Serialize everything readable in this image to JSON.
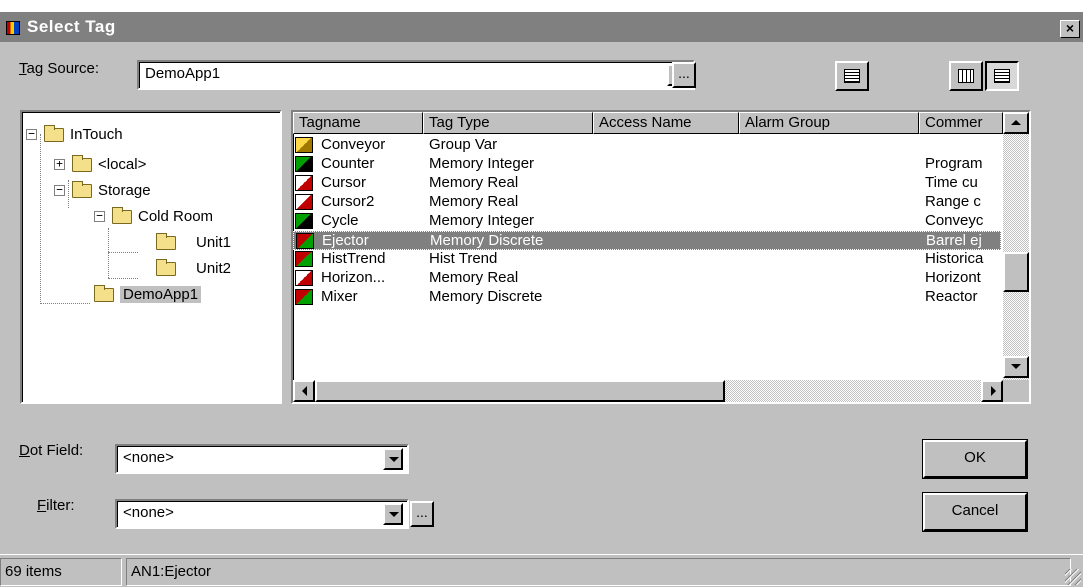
{
  "title": "Select Tag",
  "tag_source": {
    "label_accel": "T",
    "label_rest": "ag Source:",
    "value": "DemoApp1"
  },
  "tree": {
    "root": "InTouch",
    "local": "<local>",
    "storage": "Storage",
    "cold_room": "Cold Room",
    "unit1": "Unit1",
    "unit2": "Unit2",
    "demoapp": "DemoApp1"
  },
  "columns": [
    "Tagname",
    "Tag Type",
    "Access Name",
    "Alarm Group",
    "Commer"
  ],
  "rows": [
    {
      "name": "Conveyor",
      "type": "Group Var",
      "comment": "",
      "icon": "group-var-icon"
    },
    {
      "name": "Counter",
      "type": "Memory Integer",
      "comment": "Program",
      "icon": "memory-integer-icon"
    },
    {
      "name": "Cursor",
      "type": "Memory Real",
      "comment": "Time cu",
      "icon": "memory-real-icon"
    },
    {
      "name": "Cursor2",
      "type": "Memory Real",
      "comment": "Range c",
      "icon": "memory-real-icon"
    },
    {
      "name": "Cycle",
      "type": "Memory Integer",
      "comment": "Conveyc",
      "icon": "memory-integer-icon"
    },
    {
      "name": "Ejector",
      "type": "Memory Discrete",
      "comment": "Barrel ej",
      "icon": "memory-discrete-icon"
    },
    {
      "name": "HistTrend",
      "type": "Hist Trend",
      "comment": "Historica",
      "icon": "hist-trend-icon"
    },
    {
      "name": "Horizon...",
      "type": "Memory Real",
      "comment": "Horizont",
      "icon": "memory-real-icon"
    },
    {
      "name": "Mixer",
      "type": "Memory Discrete",
      "comment": "Reactor",
      "icon": "memory-discrete-icon"
    }
  ],
  "selected_row": "Ejector",
  "dot_field": {
    "label_accel": "D",
    "label_rest": "ot Field:",
    "value": "<none>"
  },
  "filter": {
    "label_accel": "F",
    "label_rest": "ilter:",
    "value": "<none>"
  },
  "buttons": {
    "ok": "OK",
    "cancel": "Cancel",
    "ellipsis": "...",
    "close": "×"
  },
  "status": {
    "count": "69 items",
    "selected": "AN1:Ejector"
  },
  "colors": {
    "title_bg": "#808080",
    "face": "#c0c0c0",
    "selection": "#808080"
  }
}
